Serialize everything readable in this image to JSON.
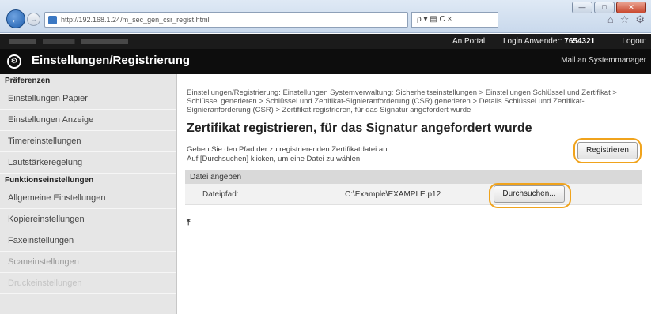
{
  "browser": {
    "address": "http://192.168.1.24/m_sec_gen_csr_regist.html",
    "addr_tools": "ρ ▾ ▤ C ×",
    "right_tools": [
      "⌂",
      "☆",
      "⚙"
    ],
    "win_buttons": [
      "—",
      "□",
      "✕"
    ],
    "back_icon": "←",
    "fwd_icon": "→"
  },
  "header": {
    "portal_link": "An Portal",
    "login_label": "Login Anwender:",
    "login_user": "7654321",
    "logout_link": "Logout",
    "app_title": "Einstellungen/Registrierung",
    "mail_link": "Mail an Systemmanager",
    "gear_icon": "⚙"
  },
  "sidebar": {
    "section_preferences": "Präferenzen",
    "items_preferences": [
      "Einstellungen Papier",
      "Einstellungen Anzeige",
      "Timereinstellungen",
      "Lautstärkeregelung"
    ],
    "section_functions": "Funktionseinstellungen",
    "items_functions": [
      "Allgemeine Einstellungen",
      "Kopiereinstellungen",
      "Faxeinstellungen",
      "Scaneinstellungen",
      "Druckeinstellungen"
    ]
  },
  "main": {
    "breadcrumb": "Einstellungen/Registrierung: Einstellungen Systemverwaltung: Sicherheitseinstellungen > Einstellungen Schlüssel und Zertifikat > Schlüssel generieren > Schlüssel und Zertifikat-Signieranforderung (CSR) generieren > Details Schlüssel und Zertifikat-Signieranforderung (CSR) > Zertifikat registrieren, für das Signatur angefordert wurde",
    "title": "Zertifikat registrieren, für das Signatur angefordert wurde",
    "instruction_line1": "Geben Sie den Pfad der zu registrierenden Zertifikatdatei an.",
    "instruction_line2": "Auf [Durchsuchen] klicken, um eine Datei zu wählen.",
    "register_button": "Registrieren",
    "section_title": "Datei angeben",
    "file_path_label": "Dateipfad:",
    "file_path_value": "C:\\Example\\EXAMPLE.p12",
    "browse_button": "Durchsuchen...",
    "top_arrow": "⤒"
  },
  "colors": {
    "highlight": "#f0a31c",
    "header_dark": "#0d0d0d",
    "sidebar_bg": "#e6e6e6"
  }
}
